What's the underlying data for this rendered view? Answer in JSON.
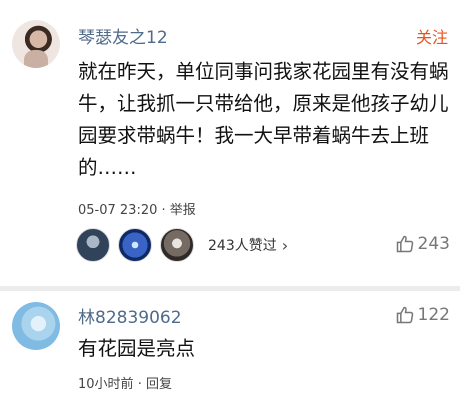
{
  "comments": [
    {
      "username": "琴瑟友之12",
      "follow_label": "关注",
      "text": "就在昨天，单位同事问我家花园里有没有蜗牛，让我抓一只带给他，原来是他孩子幼儿园要求带蜗牛！我一大早带着蜗牛去上班的……",
      "timestamp": "05-07 23:20",
      "separator": "·",
      "report_label": "举报",
      "liked_summary": "243人赞过",
      "like_count": "243"
    },
    {
      "username": "林82839062",
      "text": "有花园是亮点",
      "timestamp": "10小时前",
      "separator": "·",
      "reply_label": "回复",
      "like_count": "122"
    }
  ],
  "icons": {
    "like": "thumbs-up-icon",
    "chevron": "chevron-right-icon"
  },
  "colors": {
    "username": "#4f6b8a",
    "follow": "#e8541e",
    "like": "#777777"
  }
}
